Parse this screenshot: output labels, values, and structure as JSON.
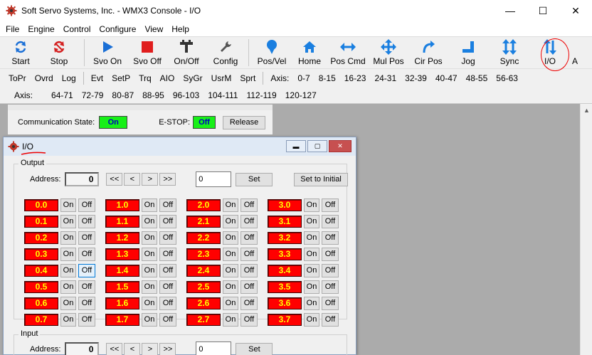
{
  "window": {
    "title": "Soft Servo Systems, Inc. - WMX3 Console - I/O",
    "controls": [
      "—",
      "☐",
      "✕"
    ]
  },
  "menu": [
    "File",
    "Engine",
    "Control",
    "Configure",
    "View",
    "Help"
  ],
  "toolbar": [
    {
      "label": "Start",
      "icon": "refresh-icon"
    },
    {
      "label": "Stop",
      "icon": "stop-refresh-icon"
    },
    {
      "sep": true
    },
    {
      "label": "Svo On",
      "icon": "play-icon"
    },
    {
      "label": "Svo Off",
      "icon": "stop-square-icon"
    },
    {
      "label": "On/Off",
      "icon": "toggle-icon"
    },
    {
      "label": "Config",
      "icon": "wrench-icon"
    },
    {
      "sep": true
    },
    {
      "label": "Pos/Vel",
      "icon": "pin-icon"
    },
    {
      "label": "Home",
      "icon": "home-icon"
    },
    {
      "label": "Pos Cmd",
      "icon": "horizontal-arrows-icon"
    },
    {
      "label": "Mul Pos",
      "icon": "cross-arrows-icon"
    },
    {
      "label": "Cir Pos",
      "icon": "curved-arrow-icon"
    },
    {
      "label": "Jog",
      "icon": "jog-icon"
    },
    {
      "label": "Sync",
      "icon": "vertical-arrows-icon"
    },
    {
      "label": "I/O",
      "icon": "io-arrows-icon"
    },
    {
      "label": "A",
      "icon": ""
    }
  ],
  "tabs_row1": [
    "ToPr",
    "Ovrd",
    "Log",
    "Evt",
    "SetP",
    "Trq",
    "AIO",
    "SyGr",
    "UsrM",
    "Sprt"
  ],
  "axis_label": "Axis:",
  "axis_row1": [
    "0-7",
    "8-15",
    "16-23",
    "24-31",
    "32-39",
    "40-47",
    "48-55",
    "56-63"
  ],
  "axis_row2": [
    "64-71",
    "72-79",
    "80-87",
    "88-95",
    "96-103",
    "104-111",
    "112-119",
    "120-127"
  ],
  "servo": {
    "comm_label": "Communication State:",
    "comm_value": "On",
    "estop_label": "E-STOP:",
    "estop_value": "Off",
    "release_label": "Release"
  },
  "io": {
    "title": "I/O",
    "output_label": "Output",
    "input_label": "Input",
    "address_label": "Address:",
    "address_value": "0",
    "nav": [
      "<<",
      "<",
      ">",
      ">>"
    ],
    "value_input": "0",
    "set_label": "Set",
    "init_label": "Set to Initial",
    "on_label": "On",
    "off_label": "Off",
    "columns": [
      [
        "0.0",
        "0.1",
        "0.2",
        "0.3",
        "0.4",
        "0.5",
        "0.6",
        "0.7"
      ],
      [
        "1.0",
        "1.1",
        "1.2",
        "1.3",
        "1.4",
        "1.5",
        "1.6",
        "1.7"
      ],
      [
        "2.0",
        "2.1",
        "2.2",
        "2.3",
        "2.4",
        "2.5",
        "2.6",
        "2.7"
      ],
      [
        "3.0",
        "3.1",
        "3.2",
        "3.3",
        "3.4",
        "3.5",
        "3.6",
        "3.7"
      ]
    ]
  },
  "colors": {
    "bit_off_bg": "#ff0000",
    "bit_text": "#ffff00",
    "state_on_bg": "#18f018",
    "state_text": "#0000c0",
    "annotation": "#e00000"
  }
}
